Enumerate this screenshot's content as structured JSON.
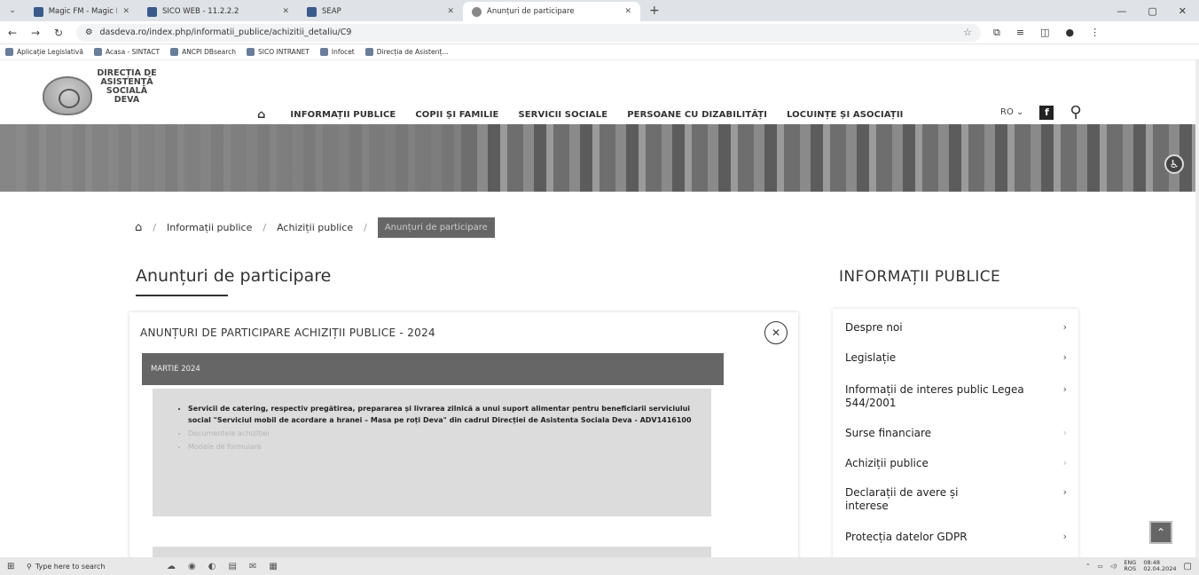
{
  "browser": {
    "tabs": [
      {
        "label": "Magic FM - Magic FM Live",
        "active": false
      },
      {
        "label": "SICO WEB - 11.2.2.2",
        "active": false
      },
      {
        "label": "SEAP",
        "active": false
      },
      {
        "label": "Anunțuri de participare",
        "active": true
      }
    ],
    "url": "dasdeva.ro/index.php/informatii_publice/achizitii_detaliu/C9",
    "bookmarks": [
      "Aplicație Legislativă",
      "Acasa - SINTACT",
      "ANCPI DBsearch",
      "SICO INTRANET",
      "Infocet",
      "Direcția de Asistenț..."
    ]
  },
  "site": {
    "logo_text": [
      "DIRECȚIA DE",
      "ASISTENȚĂ",
      "SOCIALĂ",
      "DEVA"
    ],
    "nav": [
      "INFORMAȚII PUBLICE",
      "COPII ȘI FAMILIE",
      "SERVICII SOCIALE",
      "PERSOANE CU DIZABILITĂȚI",
      "LOCUINȚE ȘI ASOCIAȚII"
    ],
    "lang": "RO",
    "facebook": "f"
  },
  "breadcrumb": [
    "Informații publice",
    "Achiziții publice",
    "Anunțuri de participare"
  ],
  "main": {
    "title": "Anunțuri de participare",
    "card_title": "ANUNȚURI DE PARTICIPARE ACHIZIȚII PUBLICE - 2024",
    "month": "MARTIE 2024",
    "item_text": "Servicii de catering, respectiv pregătirea, prepararea și livrarea zilnică a unui suport alimentar pentru beneficiarii serviciului social \"Serviciul mobil de acordare a hranei – Masa pe roți Deva\" din cadrul Direcției de Asistenta Sociala Deva - ADV1416100",
    "links": [
      "Documentele achiziției",
      "Modele de formulare"
    ]
  },
  "sidebar": {
    "title": "INFORMAȚII PUBLICE",
    "items": [
      {
        "label": "Despre noi"
      },
      {
        "label": "Legislație"
      },
      {
        "label": "Informații de interes public Legea 544/2001"
      },
      {
        "label": "Surse financiare"
      },
      {
        "label": "Achiziții publice"
      },
      {
        "label": "Declarații de avere și interese"
      },
      {
        "label": "Protecția datelor GDPR"
      }
    ]
  },
  "taskbar": {
    "search_placeholder": "Type here to search",
    "lang": "ENG",
    "layout": "ROS",
    "time": "08:48",
    "date": "02.04.2024"
  }
}
